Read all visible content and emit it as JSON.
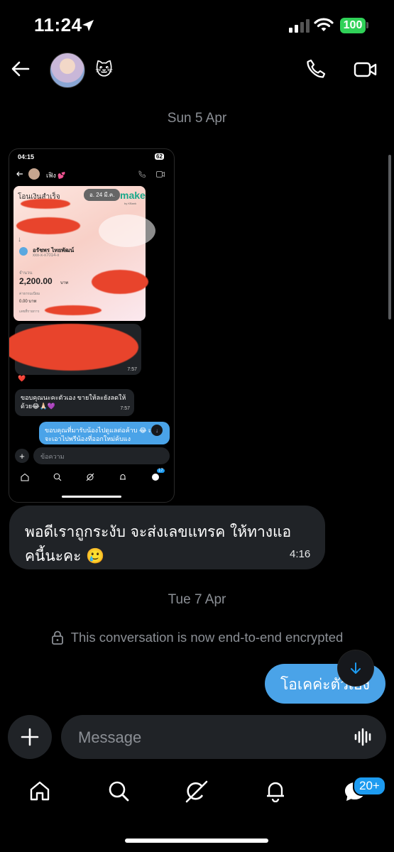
{
  "status_bar": {
    "time": "11:24",
    "battery": "100"
  },
  "header": {
    "contact_emoji": "🐱"
  },
  "date_separators": {
    "first": "Sun 5 Apr",
    "second": "Tue 7 Apr"
  },
  "embedded_screenshot": {
    "time": "04:15",
    "battery": "62",
    "contact_name": "เฟิง 💕",
    "card_title": "โอนเงินสำเร็จ",
    "card_date": "อ. 24 มี.ค.",
    "card_brand": "make",
    "card_brand_sub": "by KBank",
    "recipient_name": "อรัชพร ไทยพัฒน์",
    "recipient_account": "xxx-x-x7014-x",
    "amount_label": "จำนวน",
    "amount": "2,200.00",
    "amount_unit": "บาท",
    "fee_label": "ค่าธรรมเนียม",
    "fee": "0.00 บาท",
    "ref_label": "เลขที่รายการ",
    "msg1_time": "7:57",
    "msg1_reaction": "❤️",
    "msg2_text": "ขอบคุณนะคะตัวเอง ขายให้ละยังลดให้ด้วย😂🙏🏻💜",
    "msg2_time": "7:57",
    "msg3_text": "ขอบคุณที่มารับน้องไปดูแลต่อค้าบ 😂 เราจะเอาไปพรีน้องที่ออกใหม่ค้บแง",
    "input_placeholder": "ข้อความ",
    "badge": "17"
  },
  "messages": {
    "incoming_text": "พอดีเราถูกระงับ จะส่งเลขแทรค ให้ทางแอคนี้นะคะ 🥲",
    "incoming_time": "4:16",
    "encryption_notice": "This conversation is now end-to-end encrypted",
    "outgoing_text": "โอเคค่ะตัวเอง"
  },
  "composer": {
    "placeholder": "Message"
  },
  "bottom_nav": {
    "messages_badge": "20+"
  },
  "colors": {
    "accent": "#1d9bf0",
    "outgoing_bubble": "#4aa3e8",
    "incoming_bubble": "#202327",
    "background": "#000000"
  }
}
